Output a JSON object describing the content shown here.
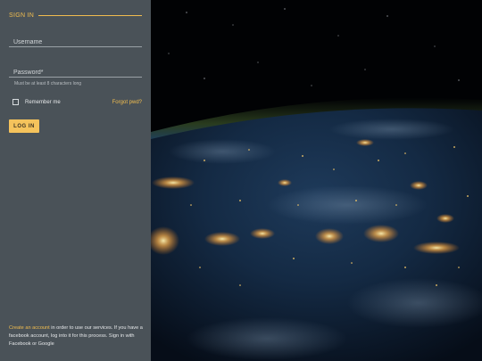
{
  "form": {
    "title": "SIGN IN",
    "username_placeholder": "Username",
    "password_placeholder": "Password*",
    "password_hint": "Must be at least 8 characters long",
    "remember_label": "Remember me",
    "forgot_link": "Forgot pwd?",
    "login_button": "LOG IN"
  },
  "footer": {
    "link_text": "Create an account",
    "text": " in order to use our services. If you have a facebook account, log into it for this process. Sign in with Facebook or Google"
  },
  "colors": {
    "panel": "#4a5258",
    "accent": "#f1bd4f",
    "button": "#f5c35c"
  }
}
